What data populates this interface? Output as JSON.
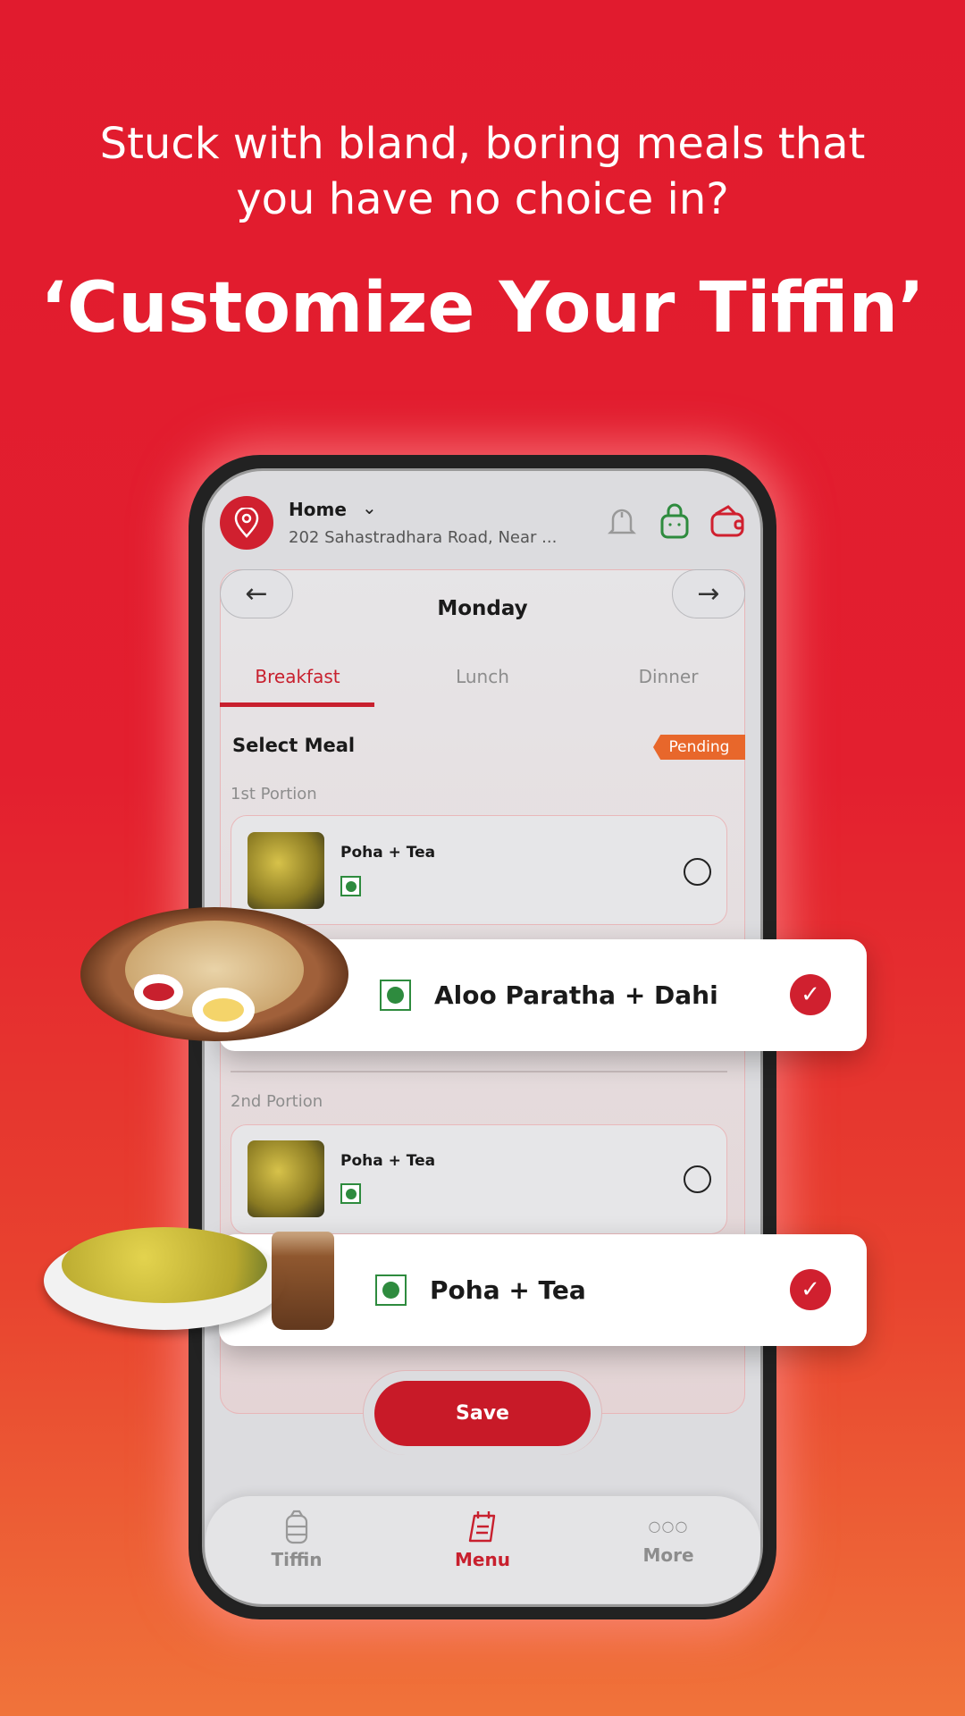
{
  "headline": {
    "line1": "Stuck with bland, boring meals that",
    "line2": "you have no choice in?",
    "title": "‘Customize Your Tiffin’"
  },
  "header": {
    "location_label": "Home",
    "address": "202 Sahastradhara Road, Near ...",
    "icons": [
      "location-pin-icon",
      "bell-icon",
      "bag-icon",
      "wallet-icon"
    ]
  },
  "day": {
    "name": "Monday",
    "prev": "←",
    "next": "→"
  },
  "tabs": [
    {
      "label": "Breakfast",
      "active": true
    },
    {
      "label": "Lunch"
    },
    {
      "label": "Dinner"
    }
  ],
  "section": {
    "title": "Select Meal",
    "status": "Pending",
    "status_color": "#e8672b"
  },
  "portions": [
    {
      "label": "1st Portion",
      "item": "Poha + Tea",
      "selected_popup": "Aloo Paratha + Dahi"
    },
    {
      "label": "2nd Portion",
      "item": "Poha + Tea",
      "selected_popup": "Poha + Tea"
    }
  ],
  "save_label": "Save",
  "bottom_nav": [
    {
      "label": "Tiffin",
      "icon": "tiffin-icon"
    },
    {
      "label": "Menu",
      "icon": "menu-calendar-icon",
      "active": true
    },
    {
      "label": "More",
      "icon": "more-dots-icon"
    }
  ],
  "colors": {
    "brand": "#d0202f",
    "veg": "#2e8b3e"
  }
}
